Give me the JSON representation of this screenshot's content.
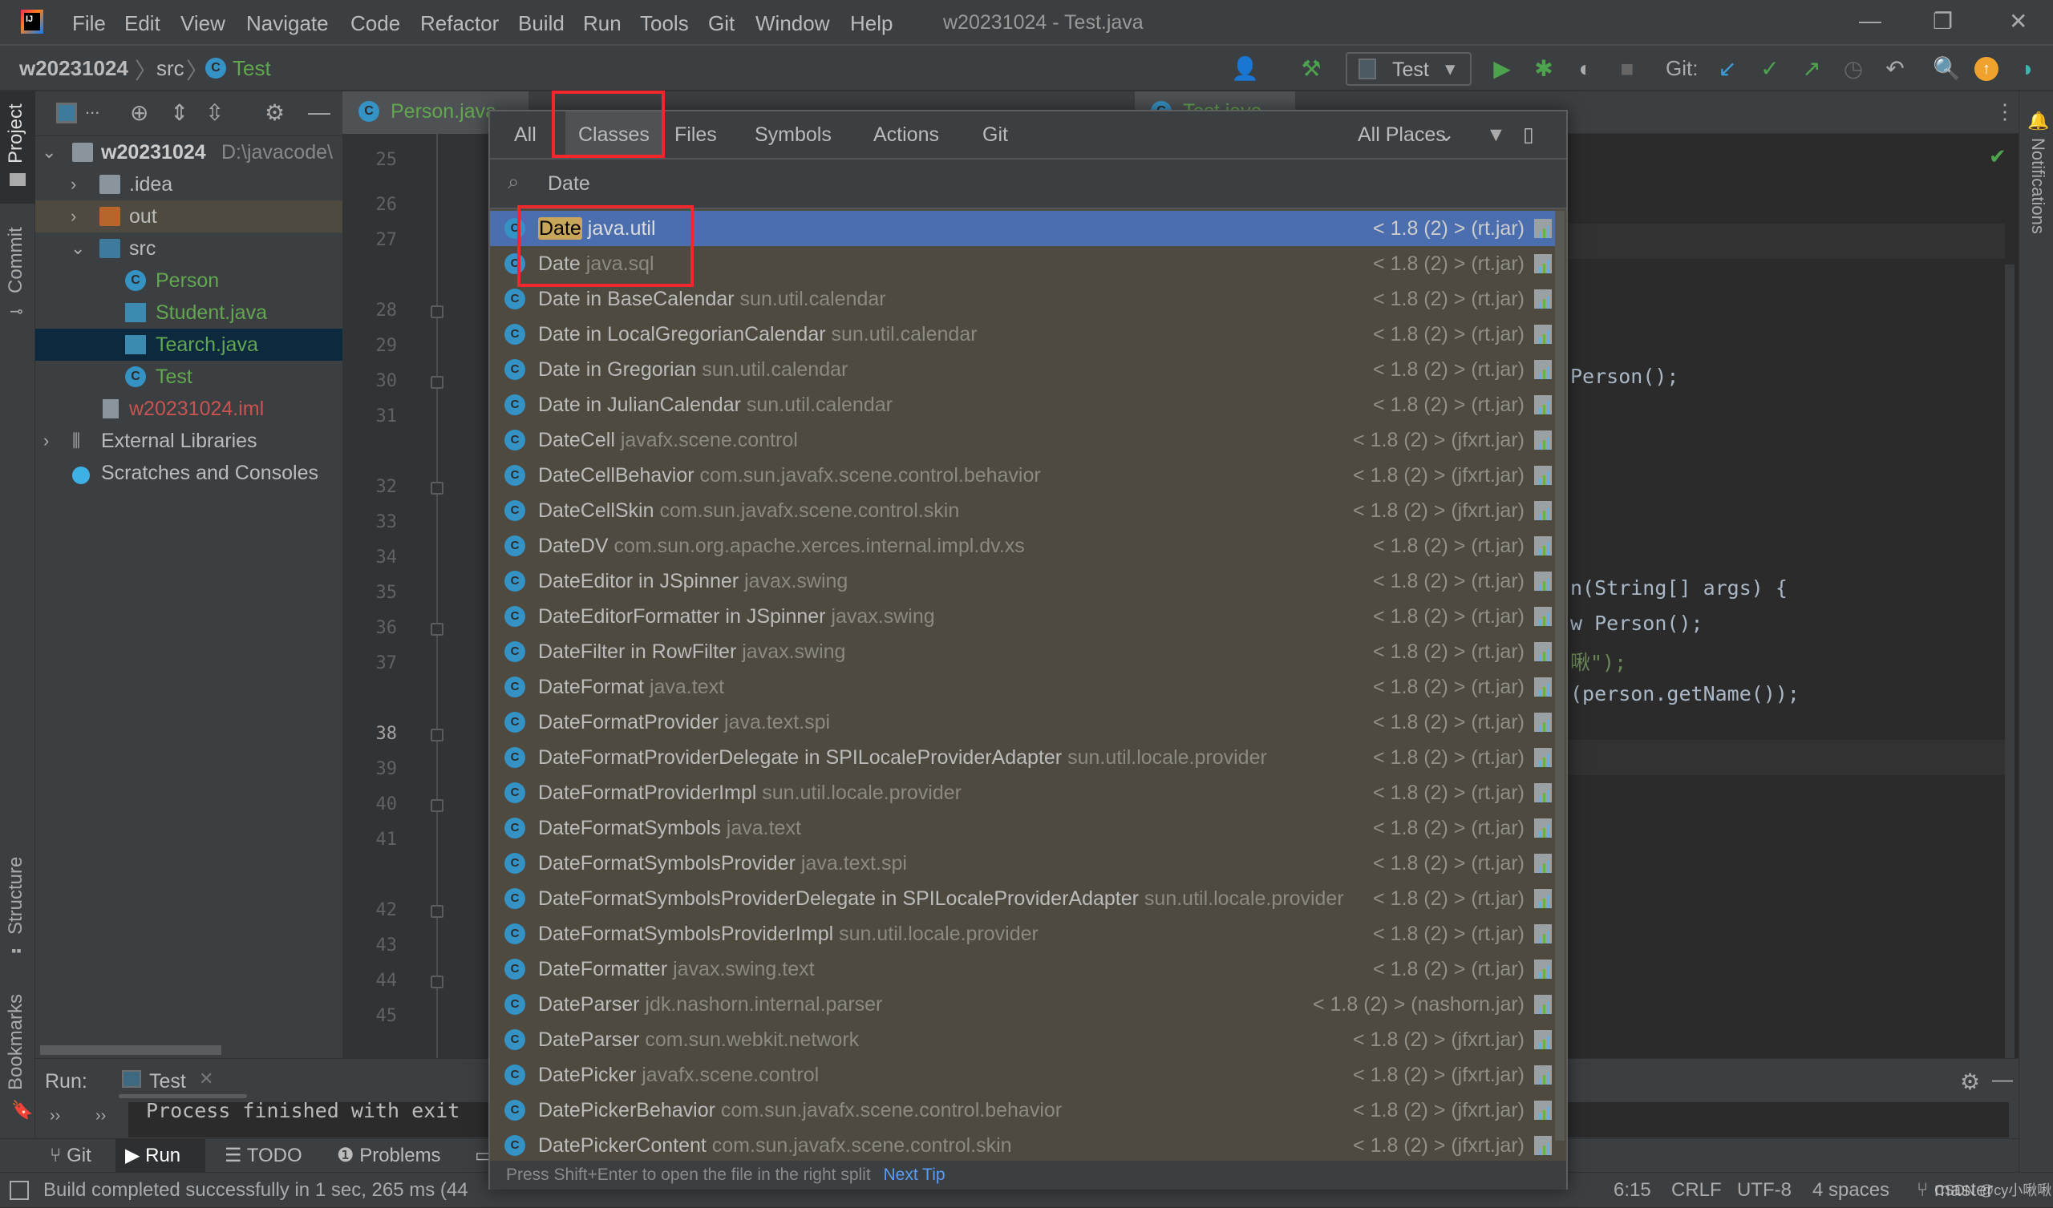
{
  "menubar": {
    "items": [
      "File",
      "Edit",
      "View",
      "Navigate",
      "Code",
      "Refactor",
      "Build",
      "Run",
      "Tools",
      "Git",
      "Window",
      "Help"
    ],
    "window_title": "w20231024 - Test.java"
  },
  "navbar": {
    "breadcrumbs": [
      "w20231024",
      "src",
      "Test"
    ],
    "run_config": "Test",
    "git_label": "Git:"
  },
  "left_strip": {
    "tabs": [
      "Project",
      "Commit",
      "Structure",
      "Bookmarks"
    ]
  },
  "right_strip": {
    "tabs": [
      "Notifications"
    ]
  },
  "project": {
    "header_label": "...",
    "tree": [
      {
        "label": "w20231024",
        "extra": "D:\\javacode\\",
        "type": "module",
        "expanded": true,
        "depth": 0
      },
      {
        "label": ".idea",
        "type": "folder",
        "expanded": false,
        "depth": 1
      },
      {
        "label": "out",
        "type": "folder-excluded",
        "expanded": false,
        "depth": 1
      },
      {
        "label": "src",
        "type": "folder-source",
        "expanded": true,
        "depth": 1
      },
      {
        "label": "Person",
        "type": "class",
        "depth": 2
      },
      {
        "label": "Student.java",
        "type": "java-file",
        "depth": 2
      },
      {
        "label": "Tearch.java",
        "type": "java-file",
        "depth": 2,
        "selected": true
      },
      {
        "label": "Test",
        "type": "class-main",
        "depth": 2
      },
      {
        "label": "w20231024.iml",
        "type": "iml",
        "depth": 1
      },
      {
        "label": "External Libraries",
        "type": "libraries",
        "expanded": false,
        "depth": 0
      },
      {
        "label": "Scratches and Consoles",
        "type": "scratches",
        "depth": 0
      }
    ]
  },
  "editor": {
    "tabs": [
      "Person.java",
      "Test.java"
    ],
    "line_numbers": [
      "25",
      "26",
      "27",
      "28",
      "29",
      "30",
      "31",
      "32",
      "33",
      "34",
      "35",
      "36",
      "37",
      "38",
      "39",
      "40",
      "41",
      "42",
      "43",
      "44",
      "45"
    ],
    "current_line": "38",
    "visible_code": [
      {
        "line": "29",
        "text": "Person();"
      },
      {
        "line": "35",
        "text": "n(String[] args) {"
      },
      {
        "line": "36",
        "text": "w Person();"
      },
      {
        "line": "37",
        "text": "啾\");"
      },
      {
        "line": "38",
        "text": "(person.getName());"
      }
    ]
  },
  "search_popup": {
    "tabs": [
      "All",
      "Classes",
      "Files",
      "Symbols",
      "Actions",
      "Git"
    ],
    "active_tab": "Classes",
    "scope": "All Places",
    "query": "Date",
    "results": [
      {
        "name": "Date",
        "package": "java.util",
        "lib": "< 1.8 (2) > (rt.jar)",
        "selected": true
      },
      {
        "name": "Date",
        "package": "java.sql",
        "lib": "< 1.8 (2) > (rt.jar)"
      },
      {
        "name": "Date in BaseCalendar",
        "package": "sun.util.calendar",
        "lib": "< 1.8 (2) > (rt.jar)"
      },
      {
        "name": "Date in LocalGregorianCalendar",
        "package": "sun.util.calendar",
        "lib": "< 1.8 (2) > (rt.jar)"
      },
      {
        "name": "Date in Gregorian",
        "package": "sun.util.calendar",
        "lib": "< 1.8 (2) > (rt.jar)"
      },
      {
        "name": "Date in JulianCalendar",
        "package": "sun.util.calendar",
        "lib": "< 1.8 (2) > (rt.jar)"
      },
      {
        "name": "DateCell",
        "package": "javafx.scene.control",
        "lib": "< 1.8 (2) > (jfxrt.jar)"
      },
      {
        "name": "DateCellBehavior",
        "package": "com.sun.javafx.scene.control.behavior",
        "lib": "< 1.8 (2) > (jfxrt.jar)"
      },
      {
        "name": "DateCellSkin",
        "package": "com.sun.javafx.scene.control.skin",
        "lib": "< 1.8 (2) > (jfxrt.jar)"
      },
      {
        "name": "DateDV",
        "package": "com.sun.org.apache.xerces.internal.impl.dv.xs",
        "lib": "< 1.8 (2) > (rt.jar)"
      },
      {
        "name": "DateEditor in JSpinner",
        "package": "javax.swing",
        "lib": "< 1.8 (2) > (rt.jar)"
      },
      {
        "name": "DateEditorFormatter in JSpinner",
        "package": "javax.swing",
        "lib": "< 1.8 (2) > (rt.jar)"
      },
      {
        "name": "DateFilter in RowFilter",
        "package": "javax.swing",
        "lib": "< 1.8 (2) > (rt.jar)"
      },
      {
        "name": "DateFormat",
        "package": "java.text",
        "lib": "< 1.8 (2) > (rt.jar)"
      },
      {
        "name": "DateFormatProvider",
        "package": "java.text.spi",
        "lib": "< 1.8 (2) > (rt.jar)"
      },
      {
        "name": "DateFormatProviderDelegate in SPILocaleProviderAdapter",
        "package": "sun.util.locale.provider",
        "lib": "< 1.8 (2) > (rt.jar)"
      },
      {
        "name": "DateFormatProviderImpl",
        "package": "sun.util.locale.provider",
        "lib": "< 1.8 (2) > (rt.jar)"
      },
      {
        "name": "DateFormatSymbols",
        "package": "java.text",
        "lib": "< 1.8 (2) > (rt.jar)"
      },
      {
        "name": "DateFormatSymbolsProvider",
        "package": "java.text.spi",
        "lib": "< 1.8 (2) > (rt.jar)"
      },
      {
        "name": "DateFormatSymbolsProviderDelegate in SPILocaleProviderAdapter",
        "package": "sun.util.locale.provider",
        "lib": "< 1.8 (2) > (rt.jar)"
      },
      {
        "name": "DateFormatSymbolsProviderImpl",
        "package": "sun.util.locale.provider",
        "lib": "< 1.8 (2) > (rt.jar)"
      },
      {
        "name": "DateFormatter",
        "package": "javax.swing.text",
        "lib": "< 1.8 (2) > (rt.jar)"
      },
      {
        "name": "DateParser",
        "package": "jdk.nashorn.internal.parser",
        "lib": "< 1.8 (2) > (nashorn.jar)"
      },
      {
        "name": "DateParser",
        "package": "com.sun.webkit.network",
        "lib": "< 1.8 (2) > (jfxrt.jar)"
      },
      {
        "name": "DatePicker",
        "package": "javafx.scene.control",
        "lib": "< 1.8 (2) > (jfxrt.jar)"
      },
      {
        "name": "DatePickerBehavior",
        "package": "com.sun.javafx.scene.control.behavior",
        "lib": "< 1.8 (2) > (jfxrt.jar)"
      },
      {
        "name": "DatePickerContent",
        "package": "com.sun.javafx.scene.control.skin",
        "lib": "< 1.8 (2) > (jfxrt.jar)"
      }
    ],
    "footer_tip": "Press Shift+Enter to open the file in the right split",
    "footer_link": "Next Tip"
  },
  "run_panel": {
    "label": "Run:",
    "tab": "Test",
    "console_text": "Process finished with exit"
  },
  "bottom_tabs": [
    "Git",
    "Run",
    "TODO",
    "Problems"
  ],
  "status_bar": {
    "message": "Build completed successfully in 1 sec, 265 ms (44",
    "position": "6:15",
    "line_sep": "CRLF",
    "encoding": "UTF-8",
    "indent": "4 spaces",
    "branch": "master"
  },
  "watermark": "CSDN @cy小啾啾",
  "colors": {
    "accent_selection": "#4b6eaf",
    "highlight_match": "#c7a65a",
    "annotation_red": "#f0282d",
    "link": "#589df6",
    "class_green": "#62a74f",
    "iml_red": "#c75450"
  }
}
